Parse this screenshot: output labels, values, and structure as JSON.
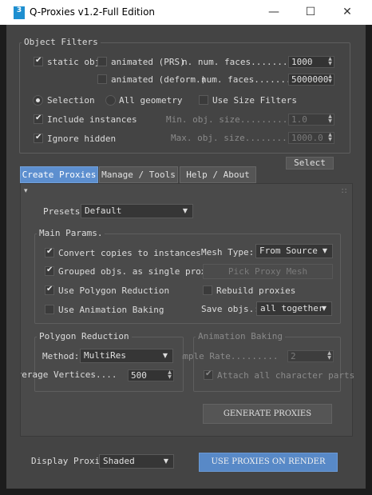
{
  "window": {
    "icon_text": "3",
    "title": "Q-Proxies v1.2-Full Edition",
    "minimize": "—",
    "maximize": "☐",
    "close": "✕"
  },
  "object_filters": {
    "label": "Object Filters",
    "static_obj": {
      "label": "static obj",
      "checked": true
    },
    "animated_prs": {
      "label": "animated (PRS)",
      "checked": false
    },
    "animated_deform": {
      "label": "animated (deform.)",
      "checked": false
    },
    "n_faces_prs_label": "n. num. faces.........",
    "n_faces_prs_value": "1000",
    "n_faces_deform_label": "num. faces........",
    "n_faces_deform_value": "5000000",
    "selection_label": "Selection",
    "all_geometry_label": "All geometry",
    "selection_mode": "Selection",
    "use_size_filters": {
      "label": "Use Size Filters",
      "checked": false
    },
    "include_instances": {
      "label": "Include instances",
      "checked": true
    },
    "ignore_hidden": {
      "label": "Ignore hidden",
      "checked": true
    },
    "min_size_label": "Min. obj. size..........",
    "min_size_value": "1.0",
    "max_size_label": "Max. obj. size.........",
    "max_size_value": "1000.0",
    "select_button": "Select"
  },
  "tabs": [
    {
      "label": "Create Proxies",
      "active": true
    },
    {
      "label": "Manage / Tools",
      "active": false
    },
    {
      "label": "Help / About",
      "active": false
    }
  ],
  "panel": {
    "collapse_arrow": "▾",
    "grip": "∷",
    "presets_label": "Presets:",
    "presets_value": "Default",
    "main_params": {
      "label": "Main Params.",
      "convert_copies": {
        "label": "Convert copies to instances",
        "checked": true
      },
      "grouped_objs": {
        "label": "Grouped objs. as single proxy",
        "checked": true
      },
      "use_polygon_reduction": {
        "label": "Use Polygon Reduction",
        "checked": true
      },
      "use_animation_baking": {
        "label": "Use Animation Baking",
        "checked": false
      },
      "mesh_type_label": "Mesh Type:",
      "mesh_type_value": "From Source",
      "pick_proxy_mesh": "Pick Proxy Mesh",
      "rebuild_proxies": {
        "label": "Rebuild proxies",
        "checked": false
      },
      "save_objs_label": "Save objs.:",
      "save_objs_value": "all together"
    },
    "polygon_reduction": {
      "label": "Polygon Reduction",
      "method_label": "Method:",
      "method_value": "MultiRes",
      "avg_vertices_label": "Average Vertices....",
      "avg_vertices_value": "500"
    },
    "animation_baking": {
      "label": "Animation Baking",
      "sample_rate_label": "Sample Rate.........",
      "sample_rate_value": "2",
      "attach_all": {
        "label": "Attach all character parts",
        "checked": true
      }
    },
    "generate_button": "GENERATE PROXIES"
  },
  "footer": {
    "display_proxies_label": "Display Proxies",
    "display_value": "Shaded",
    "use_proxies_button": "USE PROXIES ON RENDER"
  }
}
